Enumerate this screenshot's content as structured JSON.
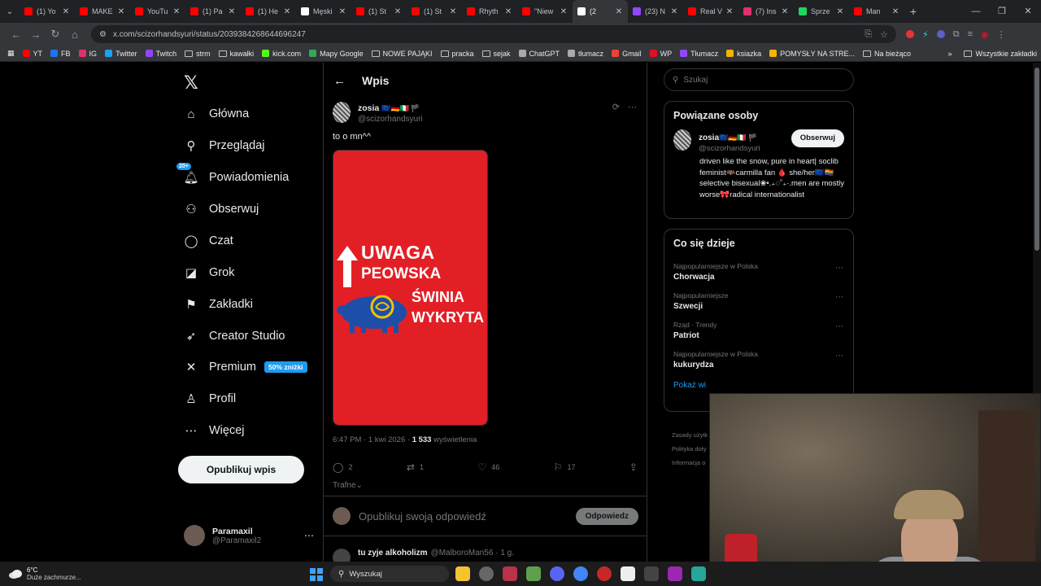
{
  "browser": {
    "tabs": [
      {
        "label": "(1) Yo",
        "color": "#ff0000"
      },
      {
        "label": "MAKE",
        "color": "#ff0000"
      },
      {
        "label": "YouTu",
        "color": "#ff0000"
      },
      {
        "label": "(1) Pa",
        "color": "#ff0000"
      },
      {
        "label": "(1) He",
        "color": "#ff0000"
      },
      {
        "label": "Męski",
        "color": "#ffffff"
      },
      {
        "label": "(1) St",
        "color": "#ff0000"
      },
      {
        "label": "(1) St",
        "color": "#ff0000"
      },
      {
        "label": "Rhyth",
        "color": "#ff0000"
      },
      {
        "label": "\"Niew",
        "color": "#ff0000"
      },
      {
        "label": "(2",
        "color": "#ffffff",
        "active": true
      },
      {
        "label": "(23) N",
        "color": "#9146ff"
      },
      {
        "label": "Real V",
        "color": "#ff0000"
      },
      {
        "label": "(7) Ins",
        "color": "#e1306c"
      },
      {
        "label": "Sprze",
        "color": "#1ed760"
      },
      {
        "label": "Man",
        "color": "#ff0000"
      }
    ],
    "url": "x.com/scizorhandsyuri/status/2039384268644696247",
    "bookmarks": [
      "YT",
      "FB",
      "IG",
      "Twitter",
      "Twitch",
      "strm",
      "kawałki",
      "kick.com",
      "Mapy Google",
      "NOWE PAJĄKI",
      "pracka",
      "sejak",
      "ChatGPT",
      "tłumacz",
      "Gmail",
      "WP",
      "Tłumacz",
      "ksiazka",
      "POMYSŁY NA STRE...",
      "Na bieżąco"
    ],
    "bookmarks_more": "»",
    "all_bookmarks": "Wszystkie zakładki"
  },
  "nav": {
    "items": [
      {
        "label": "Główna",
        "icon": "home-icon",
        "glyph": "⌂"
      },
      {
        "label": "Przeglądaj",
        "icon": "search-icon",
        "glyph": "⚲"
      },
      {
        "label": "Powiadomienia",
        "icon": "bell-icon",
        "glyph": "🔔︎",
        "badge": "20+"
      },
      {
        "label": "Obserwuj",
        "icon": "add-person-icon",
        "glyph": "⚇"
      },
      {
        "label": "Czat",
        "icon": "chat-icon",
        "glyph": "◯"
      },
      {
        "label": "Grok",
        "icon": "grok-icon",
        "glyph": "◪"
      },
      {
        "label": "Zakładki",
        "icon": "bookmark-icon",
        "glyph": "⚑"
      },
      {
        "label": "Creator Studio",
        "icon": "rocket-icon",
        "glyph": "➶"
      },
      {
        "label": "Premium",
        "icon": "x-icon",
        "glyph": "✕",
        "promo": "50% zniżki"
      },
      {
        "label": "Profil",
        "icon": "profile-icon",
        "glyph": "♙"
      },
      {
        "label": "Więcej",
        "icon": "more-icon",
        "glyph": "⋯"
      }
    ],
    "post_button": "Opublikuj wpis",
    "account": {
      "name": "Paramaxil",
      "handle": "@Paramaxil2"
    }
  },
  "post": {
    "header": "Wpis",
    "author_name": "zosia",
    "author_flags": "🇪🇺🇩🇪🇮🇹 🏴",
    "author_handle": "@scizorhandsyuri",
    "text": "to o mn^^",
    "image_text": [
      "UWAGA",
      "PEOWSKA",
      "ŚWINIA",
      "WYKRYTA"
    ],
    "time": "6:47 PM · 1 kwi 2026 · ",
    "views_count": "1 533",
    "views_label": " wyświetlenia",
    "replies": "2",
    "reposts": "1",
    "likes": "46",
    "bookmarks": "17",
    "sort": "Trafne⌄",
    "reply_placeholder": "Opublikuj swoją odpowiedź",
    "reply_button": "Odpowiedz",
    "next_name": "tu zyje alkoholizm",
    "next_handle": "@MalboroMan56 · 1 g."
  },
  "right": {
    "search_placeholder": "Szukaj",
    "related_title": "Powiązane osoby",
    "related_name": "zosia",
    "related_flags": "🇪🇺🇩🇪🇮🇹 🏴",
    "related_handle": "@scizorhandsyuri",
    "follow_button": "Obserwuj",
    "bio": "driven like the snow, pure in heart| soclib feminist🦇carmilla fan 🩸 she/her🇪🇺🏳️‍🌈selective bisexual❀•.₊◌˚₊·.men are mostly worse🎀radical internationalist",
    "trends_title": "Co się dzieje",
    "trends": [
      {
        "context": "Najpopularniejsze w Polska",
        "topic": "Chorwacja"
      },
      {
        "context": "Najpopularniejsze",
        "topic": "Szwecji"
      },
      {
        "context": "Rząd · Trendy",
        "topic": "Patriot"
      },
      {
        "context": "Najpopularniejsze w Polska",
        "topic": "kukurydza"
      }
    ],
    "show_more": "Pokaż wi",
    "footer": [
      "Zasady użytk",
      "Polityka doty",
      "Informacja o"
    ]
  },
  "taskbar": {
    "temp": "6°C",
    "weather": "Duże zachmurze...",
    "search": "Wyszukaj"
  },
  "colors": {
    "accent": "#1d9bf0",
    "background": "#000000",
    "image_bg": "#e31f26"
  }
}
